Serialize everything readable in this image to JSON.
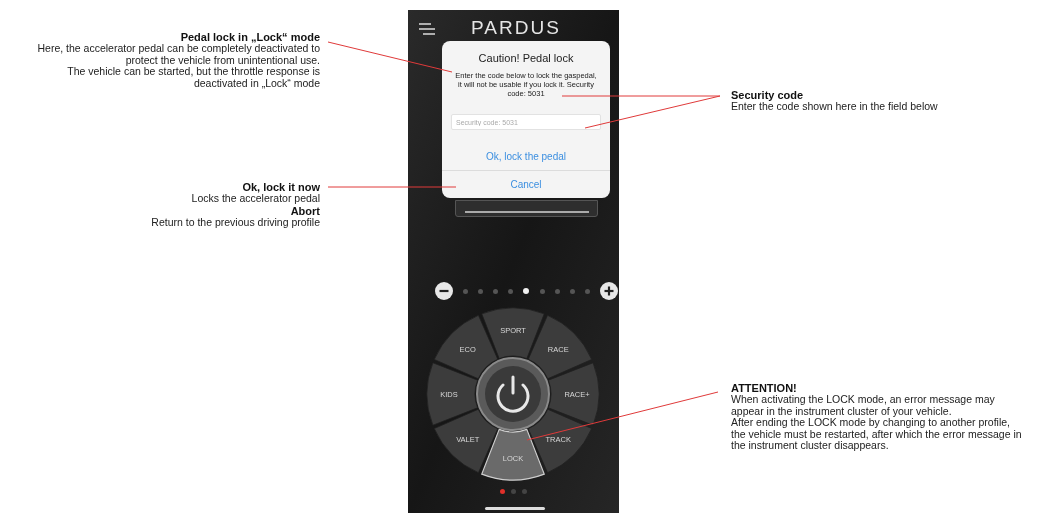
{
  "phone": {
    "app_title": "PARDUS",
    "dialog": {
      "title": "Caution! Pedal lock",
      "message": "Enter the code below to lock the gaspedal, it will not be usable if you lock it. Security code: 5031",
      "input": {
        "placeholder": "Security code: 5031"
      },
      "buttons": [
        "Ok, lock the pedal",
        "Cancel"
      ]
    },
    "intensity_dots": [
      {
        "selected": false
      },
      {
        "selected": false
      },
      {
        "selected": false
      },
      {
        "selected": false
      },
      {
        "selected": true
      },
      {
        "selected": false
      },
      {
        "selected": false
      },
      {
        "selected": false
      },
      {
        "selected": false
      }
    ],
    "profiles": [
      {
        "label": "SPORT",
        "selected": false
      },
      {
        "label": "RACE",
        "selected": false
      },
      {
        "label": "RACE+",
        "selected": false
      },
      {
        "label": "TRACK",
        "selected": false
      },
      {
        "label": "LOCK",
        "selected": true
      },
      {
        "label": "VALET",
        "selected": false
      },
      {
        "label": "KIDS",
        "selected": false
      },
      {
        "label": "ECO",
        "selected": false
      }
    ],
    "page_dots": [
      {
        "selected": true
      },
      {
        "selected": false
      },
      {
        "selected": false
      }
    ]
  },
  "annotations": [
    {
      "items": [
        {
          "title": "Pedal lock in „Lock“ mode",
          "text": "Here, the accelerator pedal can be completely deactivated to\nprotect the vehicle from unintentional use.\nThe vehicle can be started, but the throttle response is\ndeactivated in „Lock“ mode"
        }
      ]
    },
    {
      "items": [
        {
          "title": "Ok, lock it now",
          "text": "Locks the accelerator pedal"
        },
        {
          "title": "Abort",
          "text": "Return to the previous driving profile"
        }
      ]
    },
    {
      "items": [
        {
          "title": "Security code",
          "text": "Enter the code shown here in the field below"
        }
      ]
    },
    {
      "items": [
        {
          "title": "ATTENTION!",
          "text": "When activating the LOCK mode, an error message may\nappear in the instrument cluster of your vehicle.\nAfter ending the LOCK mode by changing to another profile,\nthe vehicle must be restarted, after which the error message in\nthe instrument cluster disappears."
        }
      ]
    }
  ]
}
